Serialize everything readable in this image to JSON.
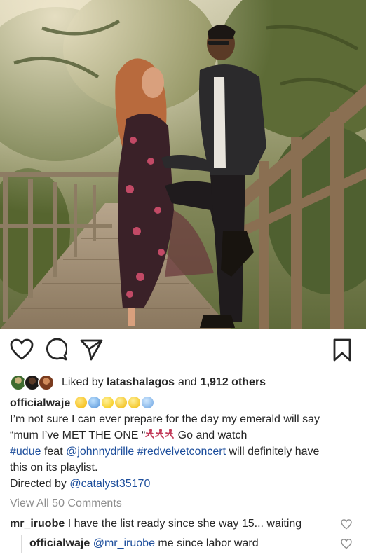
{
  "post": {
    "likes": {
      "prefix": "Liked by",
      "liked_by_user": "latashalagos",
      "and": "and",
      "others": "1,912 others"
    },
    "caption": {
      "username": "officialwaje",
      "line1": "I’m not sure I can ever prepare for the day my emerald will say",
      "line2_start": "“mum I’ve MET THE ONE “",
      "line2_end": " Go and watch",
      "hashtag1": "#udue",
      "feat": " feat ",
      "mention1": "@johnnydrille",
      "hashtag2": "#redvelvetconcert",
      "line3_end": " will definitely have",
      "line4": "this on its playlist.",
      "directed_by": "Directed by ",
      "mention2": "@catalyst35170"
    },
    "view_all_comments": "View All 50 Comments",
    "comments": [
      {
        "username": "mr_iruobe",
        "text": " I have the list ready since she way 15... waiting"
      },
      {
        "username": "officialwaje",
        "mention": "@mr_iruobe",
        "text": " me since labor ward"
      }
    ]
  },
  "icons": {
    "like": "heart-outline-icon",
    "comment": "speech-bubble-icon",
    "share": "paper-plane-icon",
    "save": "bookmark-icon",
    "emoji_row": [
      "grimacing-emoji",
      "sweat-emoji",
      "smiling-emoji",
      "smiley-emoji",
      "grin-emoji",
      "fearful-emoji"
    ],
    "runner": "runner-emoji"
  },
  "colors": {
    "text": "#262626",
    "link": "#1d4e9c",
    "muted": "#8e8e8e"
  }
}
